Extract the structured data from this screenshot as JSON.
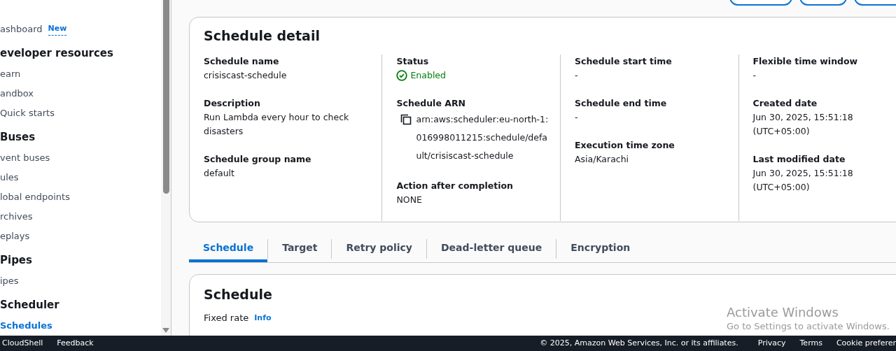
{
  "sidebar": {
    "items": [
      {
        "kind": "link",
        "label": "ashboard",
        "badge": "New",
        "selected": false
      },
      {
        "kind": "section",
        "label": "eveloper resources"
      },
      {
        "kind": "link",
        "label": "earn",
        "selected": false
      },
      {
        "kind": "link",
        "label": "andbox",
        "selected": false
      },
      {
        "kind": "link",
        "label": "Quick starts",
        "selected": false
      },
      {
        "kind": "section",
        "label": "Buses"
      },
      {
        "kind": "link",
        "label": "vent buses",
        "selected": false
      },
      {
        "kind": "link",
        "label": "ules",
        "selected": false
      },
      {
        "kind": "link",
        "label": "lobal endpoints",
        "selected": false
      },
      {
        "kind": "link",
        "label": "rchives",
        "selected": false
      },
      {
        "kind": "link",
        "label": "eplays",
        "selected": false
      },
      {
        "kind": "section",
        "label": "Pipes"
      },
      {
        "kind": "link",
        "label": "ipes",
        "selected": false
      },
      {
        "kind": "section",
        "label": "Scheduler"
      },
      {
        "kind": "link",
        "label": "Schedules",
        "selected": true
      }
    ]
  },
  "detail": {
    "title": "Schedule detail",
    "columns": [
      [
        {
          "label": "Schedule name",
          "value": "crisiscast-schedule"
        },
        {
          "label": "Description",
          "value": "Run Lambda every hour to check disasters"
        },
        {
          "label": "Schedule group name",
          "value": "default"
        }
      ],
      [
        {
          "label": "Status",
          "value": "Enabled",
          "kind": "status"
        },
        {
          "label": "Schedule ARN",
          "value": "arn:aws:scheduler:eu-north-1:016998011215:schedule/default/crisiscast-schedule",
          "kind": "copy"
        },
        {
          "label": "Action after completion",
          "value": "NONE"
        }
      ],
      [
        {
          "label": "Schedule start time",
          "value": "-"
        },
        {
          "label": "Schedule end time",
          "value": "-"
        },
        {
          "label": "Execution time zone",
          "value": "Asia/Karachi"
        }
      ],
      [
        {
          "label": "Flexible time window",
          "value": "-"
        },
        {
          "label": "Created date",
          "value": "Jun 30, 2025, 15:51:18 (UTC+05:00)"
        },
        {
          "label": "Last modified date",
          "value": "Jun 30, 2025, 15:51:18 (UTC+05:00)"
        }
      ]
    ]
  },
  "tabs": [
    {
      "label": "Schedule",
      "selected": true
    },
    {
      "label": "Target",
      "selected": false
    },
    {
      "label": "Retry policy",
      "selected": false
    },
    {
      "label": "Dead-letter queue",
      "selected": false
    },
    {
      "label": "Encryption",
      "selected": false
    }
  ],
  "schedule": {
    "title": "Schedule",
    "field_label": "Fixed rate",
    "info": "Info"
  },
  "os_notice": {
    "title": "Activate Windows",
    "text": "Go to Settings to activate Windows."
  },
  "footer": {
    "left": [
      "CloudShell",
      "Feedback"
    ],
    "copyright": "© 2025, Amazon Web Services, Inc. or its affiliates.",
    "right": [
      "Privacy",
      "Terms",
      "Cookie preferer"
    ]
  }
}
